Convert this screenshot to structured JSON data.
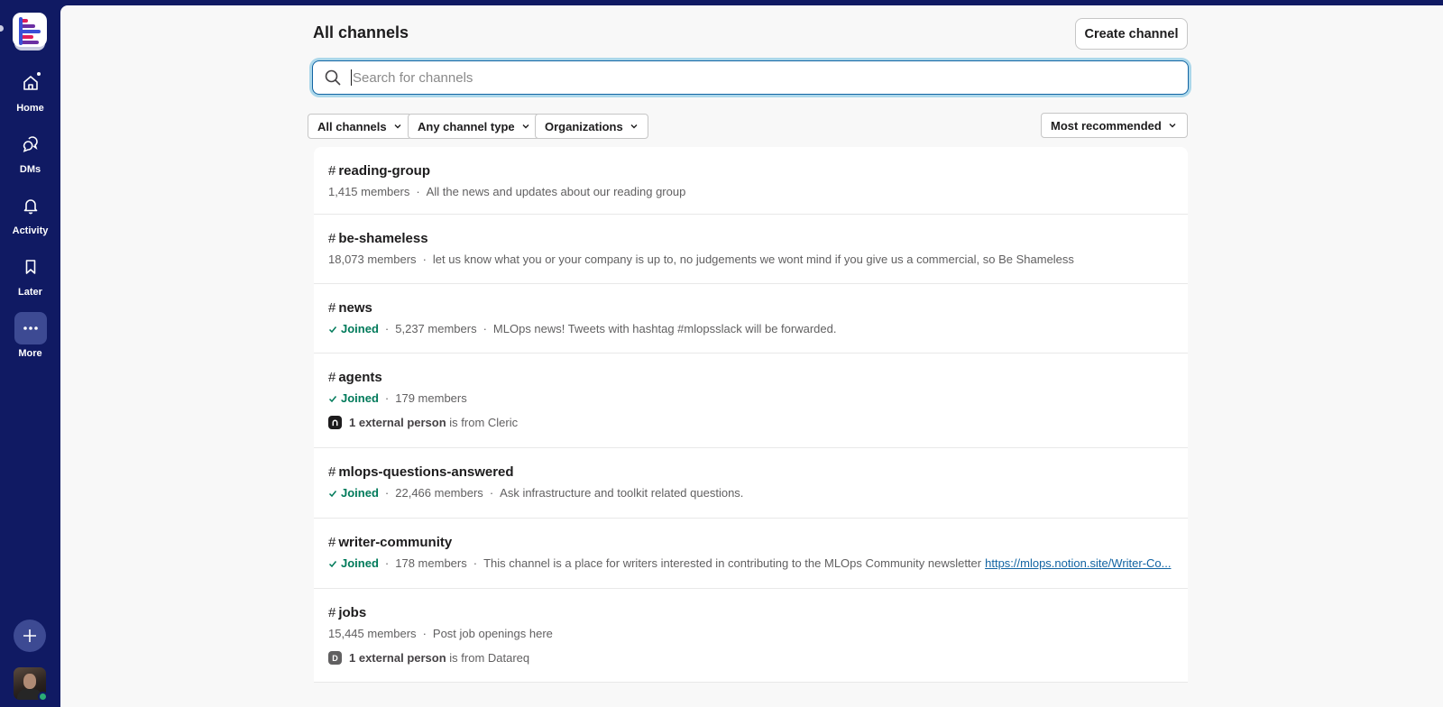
{
  "rail": {
    "nav": [
      {
        "label": "Home",
        "icon": "home-icon",
        "has_notification": true
      },
      {
        "label": "DMs",
        "icon": "dms-icon"
      },
      {
        "label": "Activity",
        "icon": "bell-icon"
      },
      {
        "label": "Later",
        "icon": "bookmark-icon"
      },
      {
        "label": "More",
        "icon": "more-icon",
        "active": true
      }
    ]
  },
  "header": {
    "title": "All channels",
    "create_label": "Create channel"
  },
  "search": {
    "placeholder": "Search for channels",
    "value": ""
  },
  "filters": {
    "all_channels": "All channels",
    "channel_type": "Any channel type",
    "organizations": "Organizations",
    "sort": "Most recommended"
  },
  "channels": [
    {
      "name": "reading-group",
      "members": "1,415 members",
      "description": "All the news and updates about our reading group"
    },
    {
      "name": "be-shameless",
      "members": "18,073 members",
      "description": "let us know what you or your company is up to, no judgements we wont mind if you give us a commercial, so Be Shameless"
    },
    {
      "name": "news",
      "joined": "Joined",
      "members": "5,237 members",
      "description": "MLOps news! Tweets with hashtag #mlopsslack will be forwarded."
    },
    {
      "name": "agents",
      "joined": "Joined",
      "members": "179 members",
      "external_count": "1 external person",
      "external_org": "is from Cleric"
    },
    {
      "name": "mlops-questions-answered",
      "joined": "Joined",
      "members": "22,466 members",
      "description": "Ask infrastructure and toolkit related questions."
    },
    {
      "name": "writer-community",
      "joined": "Joined",
      "members": "178 members",
      "description": "This channel is a place for writers interested in contributing to the MLOps Community newsletter",
      "link": "https://mlops.notion.site/Writer-Co..."
    },
    {
      "name": "jobs",
      "members": "15,445 members",
      "description": "Post job openings here",
      "external_count": "1 external person",
      "external_org": "is from Datareq",
      "external_icon_letter": "D"
    }
  ],
  "colors": {
    "rail": "#101a63",
    "joined": "#007a5a",
    "link": "#1264a3",
    "focus": "#1264a3"
  }
}
